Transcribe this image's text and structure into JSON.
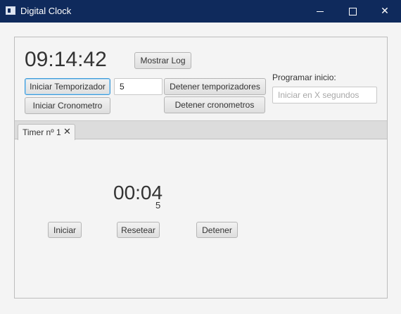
{
  "window": {
    "title": "Digital Clock",
    "icon": "app-window-icon"
  },
  "clock": {
    "time": "09:14:42"
  },
  "buttons": {
    "mostrar_log": "Mostrar Log",
    "iniciar_temporizador": "Iniciar Temporizador",
    "iniciar_cronometro": "Iniciar Cronometro",
    "detener_temporizadores": "Detener temporizadores",
    "detener_cronometros": "Detener cronometros"
  },
  "timer_input": {
    "value": "5"
  },
  "schedule": {
    "label": "Programar inicio:",
    "placeholder": "Iniciar en X segundos"
  },
  "tabs": [
    {
      "label": "Timer nº 1",
      "close": "✕"
    }
  ],
  "timer_panel": {
    "display": "00:04",
    "subvalue": "5",
    "buttons": {
      "start": "Iniciar",
      "reset": "Resetear",
      "stop": "Detener"
    }
  }
}
